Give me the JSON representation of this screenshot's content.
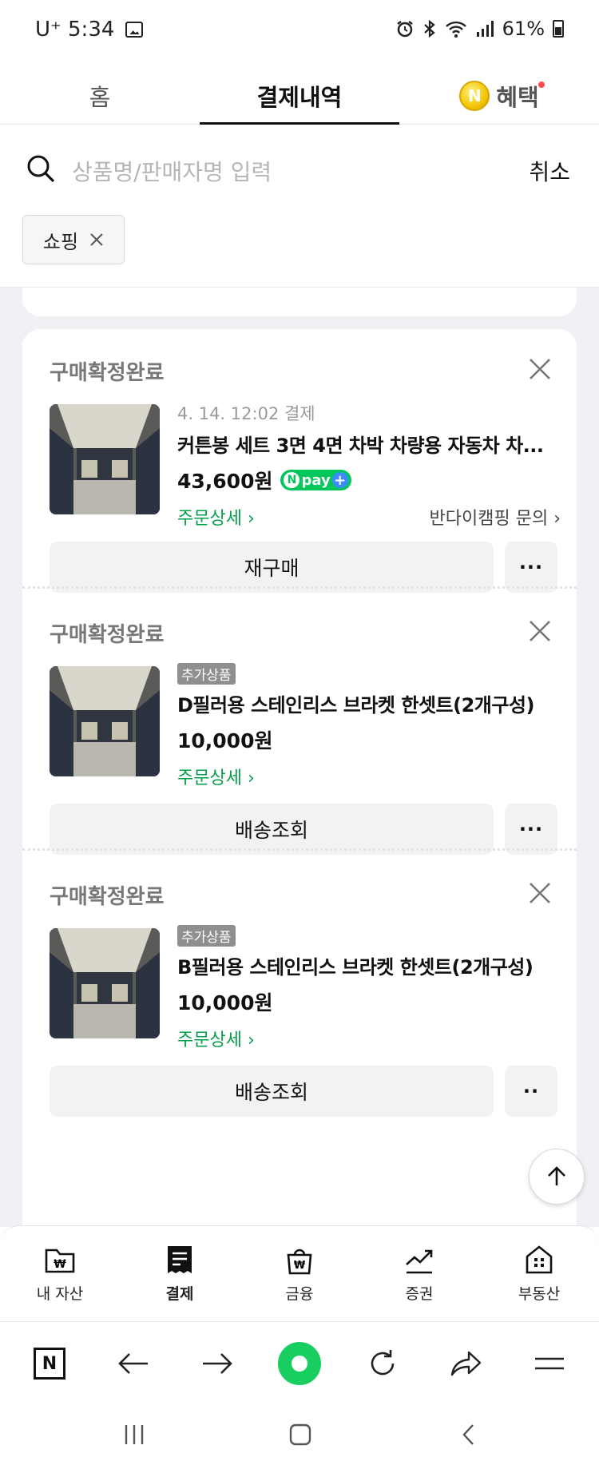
{
  "status_bar": {
    "carrier_time": "U⁺ 5:34",
    "battery": "61%"
  },
  "tabs": {
    "home": "홈",
    "payments": "결제내역",
    "benefits": "혜택",
    "benefit_coin": "N"
  },
  "search": {
    "placeholder": "상품명/판매자명 입력",
    "cancel": "취소"
  },
  "filter": {
    "chip": "쇼핑"
  },
  "orders": [
    {
      "status": "구매확정완료",
      "date": "4. 14. 12:02 결제",
      "tag": "",
      "title": "커튼봉 세트 3면 4면 차박 차량용 자동차 차...",
      "price": "43,600원",
      "npay": "pay",
      "detail": "주문상세 ›",
      "seller": "반다이캠핑 문의 ›",
      "button": "재구매",
      "more": "···"
    },
    {
      "status": "구매확정완료",
      "date": "",
      "tag": "추가상품",
      "title": "D필러용 스테인리스 브라켓 한셋트(2개구성)",
      "price": "10,000원",
      "npay": "",
      "detail": "주문상세 ›",
      "seller": "",
      "button": "배송조회",
      "more": "···"
    },
    {
      "status": "구매확정완료",
      "date": "",
      "tag": "추가상품",
      "title": "B필러용 스테인리스 브라켓 한셋트(2개구성)",
      "price": "10,000원",
      "npay": "",
      "detail": "주문상세 ›",
      "seller": "",
      "button": "배송조회",
      "more": "··"
    }
  ],
  "bottom_nav": [
    {
      "label": "내 자산",
      "icon": "wallet-folder-icon"
    },
    {
      "label": "결제",
      "icon": "receipt-icon"
    },
    {
      "label": "금융",
      "icon": "money-bag-icon"
    },
    {
      "label": "증권",
      "icon": "stock-chart-icon"
    },
    {
      "label": "부동산",
      "icon": "building-icon"
    }
  ],
  "browser_bar": {
    "home_logo": "N"
  },
  "colors": {
    "green": "#03c75a",
    "detail_green": "#03a04b",
    "bg": "#f0f1f5"
  }
}
